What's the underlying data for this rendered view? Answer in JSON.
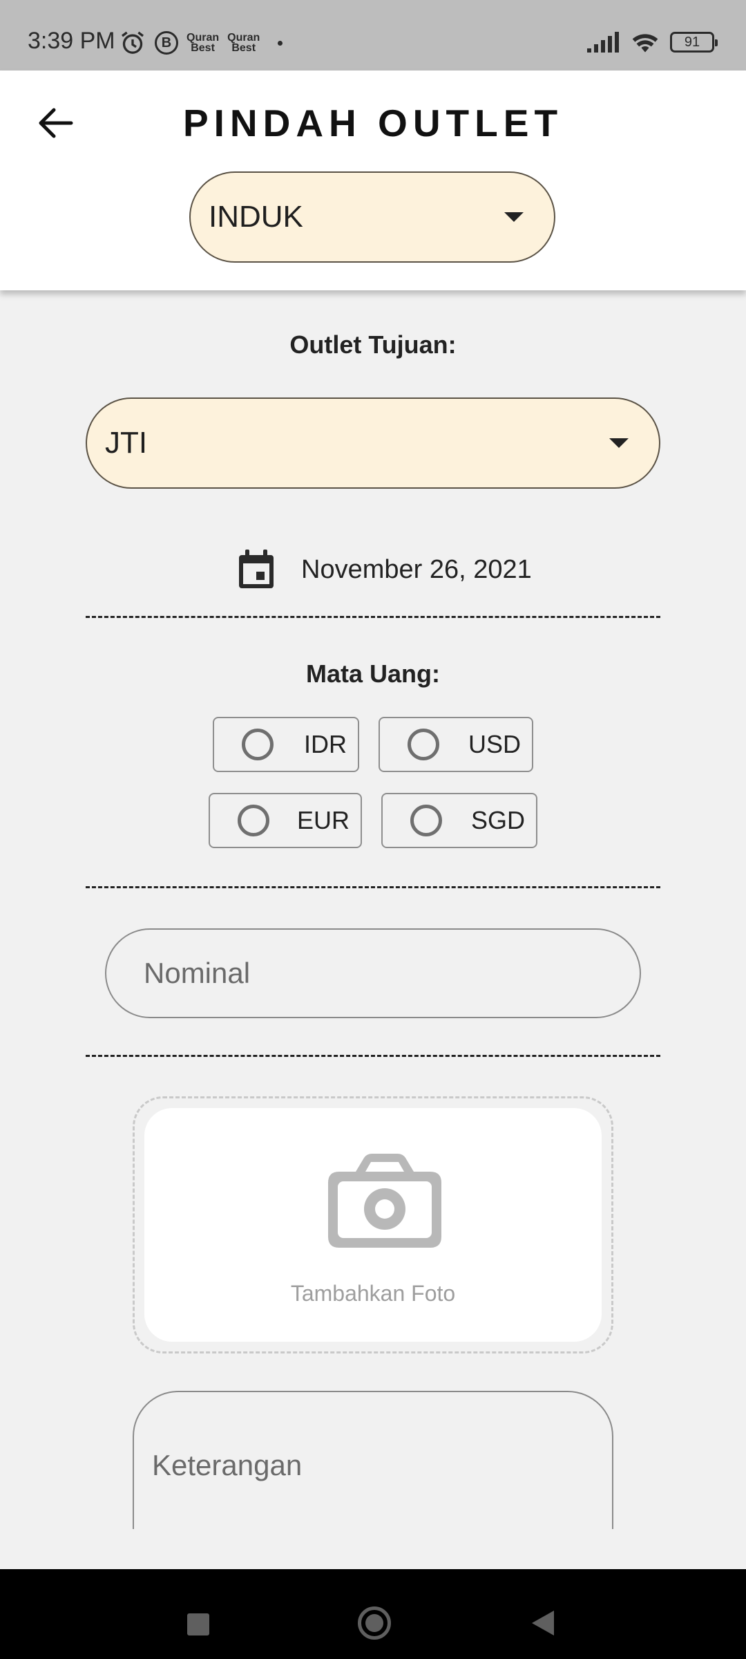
{
  "status_bar": {
    "time": "3:39 PM",
    "b_badge": "B",
    "quran_top": "Quran",
    "quran_bottom": "Best",
    "battery": "91"
  },
  "header": {
    "title": "PINDAH OUTLET",
    "outlet_selected": "INDUK"
  },
  "form": {
    "target_label": "Outlet Tujuan:",
    "target_selected": "JTI",
    "date": "November 26, 2021",
    "currency_label": "Mata Uang:",
    "currencies": [
      "IDR",
      "USD",
      "EUR",
      "SGD"
    ],
    "nominal_placeholder": "Nominal",
    "photo_label": "Tambahkan Foto",
    "keterangan_placeholder": "Keterangan"
  },
  "icons": {
    "back": "arrow-left-icon",
    "calendar": "calendar-icon",
    "camera": "camera-icon",
    "dropdown": "caret-down-icon",
    "radio": "radio-unchecked-icon"
  },
  "colors": {
    "dropdown_fill": "#fdf2dc",
    "background": "#f1f1f1",
    "status_bar": "#bdbdbd",
    "nav_bar": "#000000"
  }
}
